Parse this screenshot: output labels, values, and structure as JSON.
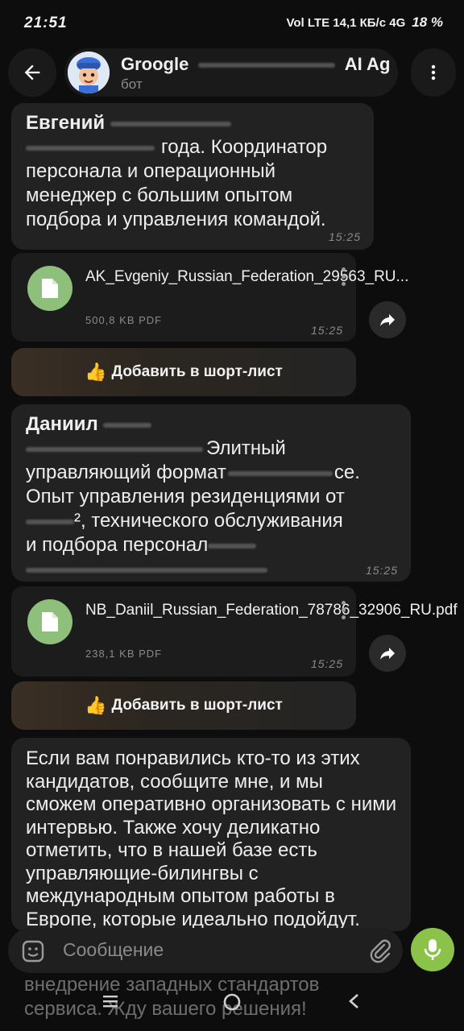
{
  "status": {
    "time": "21:51",
    "right": "Vol LTE 14,1 КБ/с 4G",
    "battery": "18 %"
  },
  "header": {
    "name": "Groogle",
    "name_tail": "AI Age",
    "subtitle": "бот"
  },
  "messages": [
    {
      "title": "Евгений",
      "lines": [
        "года. Координатор",
        "персонала и операционный",
        "менеджер с большим опытом",
        "подбора и управления командой."
      ],
      "time": "15:25"
    },
    {
      "title": "Даниил",
      "lines": [
        "Элитный",
        "управляющий формат",
        "ce.",
        "Опыт управления резиденциями от",
        "², технического обслуживания",
        "и подбора персонал"
      ],
      "time": "15:25"
    }
  ],
  "files": [
    {
      "name": "AK_Evgeniy_Russian_Federation_29563_RU...",
      "size": "500,8 KB PDF",
      "time": "15:25"
    },
    {
      "name": "NB_Daniil_Russian_Federation_78786_32906_RU.pdf",
      "size": "238,1 KB PDF",
      "time": "15:25"
    }
  ],
  "shortlist_label": "Добавить в шорт-лист",
  "final_message": {
    "text": "Если вам понравились кто-то из этих кандидатов, сообщите мне, и мы сможем оперативно организовать с ними интервью. Также хочу деликатно отметить, что в нашей базе есть управляющие-билингвы с международным опытом работы в Европе, которые идеально подойдут.",
    "under_line1": "внедрение западных стандартов",
    "under_line2": "сервиса. Жду вашего решения!"
  },
  "input": {
    "placeholder": "Сообщение"
  },
  "icons": {
    "back": "arrow-left-icon",
    "menu": "more-vert-icon",
    "file": "file-icon",
    "share": "share-icon",
    "emoji": "emoji-icon",
    "attach": "paperclip-icon",
    "mic": "mic-icon"
  },
  "colors": {
    "accent": "#8bc34a",
    "bubble": "#222222",
    "background": "#0d0d0d"
  }
}
